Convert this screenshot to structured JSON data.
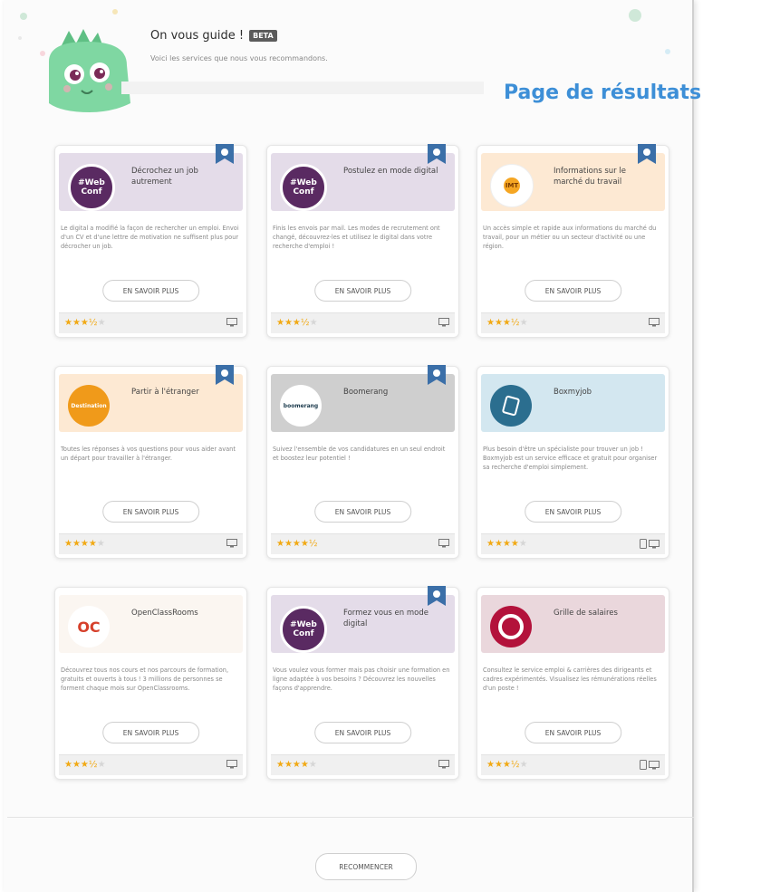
{
  "header": {
    "title": "On vous guide !",
    "beta": "BETA",
    "subtitle": "Voici les services que nous vous recommandons."
  },
  "page_label": "Page de résultats",
  "cards": [
    {
      "title": "Décrochez un job autrement",
      "description": "Le digital a modifié la façon de rechercher un emploi. Envoi d'un CV et d'une lettre de motivation ne suffisent plus pour décrocher un job.",
      "button": "EN SAVOIR PLUS",
      "rating": 3.5,
      "logo_text": "#Web Conf"
    },
    {
      "title": "Postulez en mode digital",
      "description": "Finis les envois par mail. Les modes de recrutement ont changé, découvrez-les et utilisez le digital dans votre recherche d'emploi !",
      "button": "EN SAVOIR PLUS",
      "rating": 3.5,
      "logo_text": "#Web Conf"
    },
    {
      "title": "Informations sur le marché du travail",
      "description": "Un accès simple et rapide aux informations du marché du travail, pour un métier ou un secteur d'activité ou une région.",
      "button": "EN SAVOIR PLUS",
      "rating": 3.5,
      "logo_text": "IMT"
    },
    {
      "title": "Partir à l'étranger",
      "description": "Toutes les réponses à vos questions pour vous aider avant un départ pour travailler à l'étranger.",
      "button": "EN SAVOIR PLUS",
      "rating": 4,
      "logo_text": "Destination"
    },
    {
      "title": "Boomerang",
      "description": "Suivez l'ensemble de vos candidatures en un seul endroit et boostez leur potentiel !",
      "button": "EN SAVOIR PLUS",
      "rating": 4.5,
      "logo_text": "boomerang"
    },
    {
      "title": "Boxmyjob",
      "description": "Plus besoin d'être un spécialiste pour trouver un job ! Boxmyjob est un service efficace et gratuit pour organiser sa recherche d'emploi simplement.",
      "button": "EN SAVOIR PLUS",
      "rating": 4,
      "logo_text": ""
    },
    {
      "title": "OpenClassRooms",
      "description": "Découvrez tous nos cours et nos parcours de formation, gratuits et ouverts à tous ! 3 millions de personnes se forment chaque mois sur OpenClassrooms.",
      "button": "EN SAVOIR PLUS",
      "rating": 3.5,
      "logo_text": "OC"
    },
    {
      "title": "Formez vous en mode digital",
      "description": "Vous voulez vous former mais pas choisir une formation en ligne adaptée à vos besoins ? Découvrez les nouvelles façons d'apprendre.",
      "button": "EN SAVOIR PLUS",
      "rating": 4,
      "logo_text": "#Web Conf"
    },
    {
      "title": "Grille de salaires",
      "description": "Consultez le service emploi & carrières des dirigeants et cadres expérimentés. Visualisez les rémunérations réelles d'un poste !",
      "button": "EN SAVOIR PLUS",
      "rating": 3.5,
      "logo_text": ""
    }
  ],
  "restart_button": "RECOMMENCER",
  "colors": {
    "accent_blue": "#3d8fd7",
    "badge": "#3b6fa8",
    "purple_head": "#e4dce9",
    "peach_head": "#fde9d3",
    "grey_head": "#cfcfcf",
    "blue_head": "#d3e7f0",
    "light_head": "#fbf6f1",
    "pink_head": "#ead7dc",
    "star": "#f1a914",
    "mascot": "#7fd7a2"
  }
}
